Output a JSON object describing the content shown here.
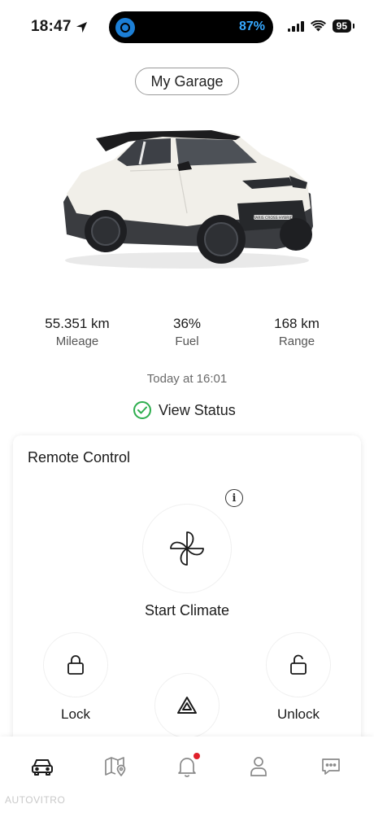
{
  "status_bar": {
    "time": "18:47",
    "island_percent": "87%",
    "battery": "95",
    "icons": [
      "location-arrow-icon",
      "signal-icon",
      "wifi-icon",
      "battery-icon"
    ]
  },
  "header": {
    "garage_button": "My Garage"
  },
  "car": {
    "plate_text": "YARIS CROSS HYBRID"
  },
  "stats": {
    "mileage_value": "55.351 km",
    "mileage_label": "Mileage",
    "fuel_value": "36%",
    "fuel_label": "Fuel",
    "range_value": "168 km",
    "range_label": "Range"
  },
  "status": {
    "timestamp": "Today at 16:01",
    "view_status": "View Status"
  },
  "remote_control": {
    "title": "Remote Control",
    "climate_label": "Start Climate",
    "lock_label": "Lock",
    "unlock_label": "Unlock"
  },
  "bottom_nav": {
    "items": [
      "car-icon",
      "map-icon",
      "bell-icon",
      "person-icon",
      "chat-icon"
    ],
    "active": "car-icon",
    "notification_color": "#e0202a"
  },
  "watermark": "AUTOVITRO",
  "colors": {
    "accent_green": "#2eae4e",
    "island_text": "#35a8ff",
    "nav_inactive": "#8a8a8a"
  }
}
